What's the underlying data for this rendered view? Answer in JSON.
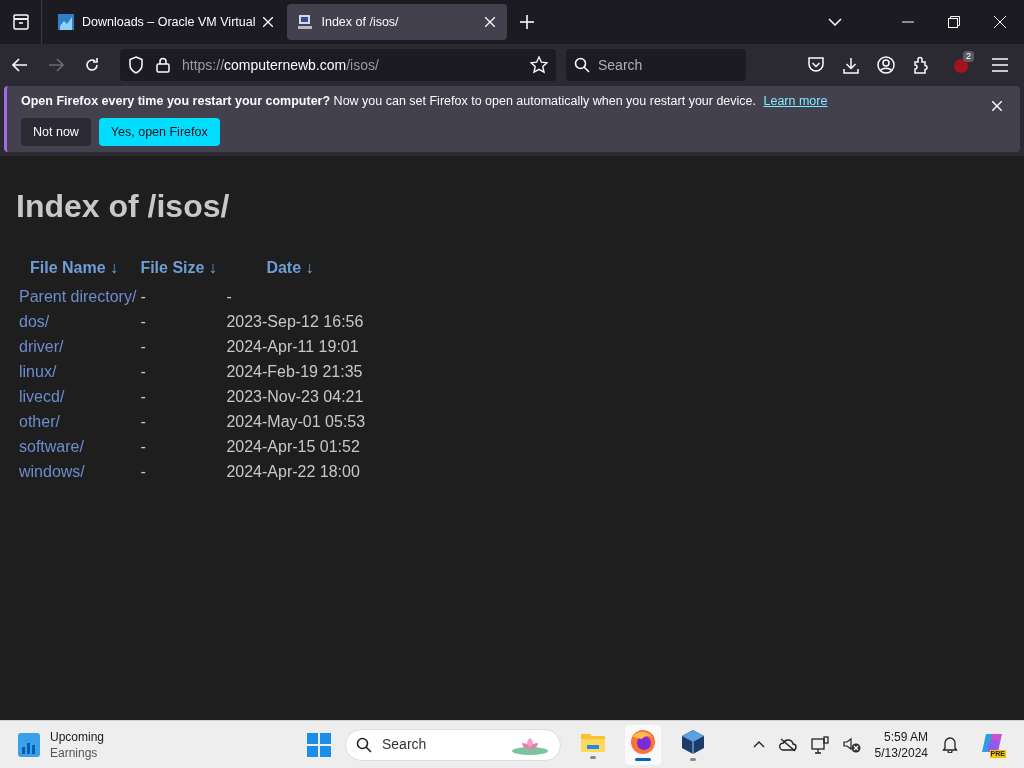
{
  "tabs": [
    {
      "title": "Downloads – Oracle VM Virtual",
      "selected": false,
      "kind": "vbox"
    },
    {
      "title": "Index of /isos/",
      "selected": true,
      "kind": "page"
    }
  ],
  "toolbar": {
    "url": {
      "scheme": "https://",
      "host": "computernewb.com",
      "path": "/isos/"
    },
    "search_placeholder": "Search",
    "extension_badge": "2"
  },
  "notification": {
    "bold": "Open Firefox every time you restart your computer?",
    "text": "Now you can set Firefox to open automatically when you restart your device.",
    "link": "Learn more",
    "buttons": [
      {
        "label": "Not now",
        "kind": "secondary"
      },
      {
        "label": "Yes, open Firefox",
        "kind": "primary"
      }
    ]
  },
  "page": {
    "title": "Index of /isos/",
    "columns": [
      {
        "label": "File Name",
        "sort": "↓"
      },
      {
        "label": "File Size",
        "sort": "↓"
      },
      {
        "label": "Date",
        "sort": "↓"
      }
    ],
    "rows": [
      {
        "name": "Parent directory/",
        "size": "-",
        "date": "-"
      },
      {
        "name": "dos/",
        "size": "-",
        "date": "2023-Sep-12 16:56"
      },
      {
        "name": "driver/",
        "size": "-",
        "date": "2024-Apr-11 19:01"
      },
      {
        "name": "linux/",
        "size": "-",
        "date": "2024-Feb-19 21:35"
      },
      {
        "name": "livecd/",
        "size": "-",
        "date": "2023-Nov-23 04:21"
      },
      {
        "name": "other/",
        "size": "-",
        "date": "2024-May-01 05:53"
      },
      {
        "name": "software/",
        "size": "-",
        "date": "2024-Apr-15 01:52"
      },
      {
        "name": "windows/",
        "size": "-",
        "date": "2024-Apr-22 18:00"
      }
    ]
  },
  "taskbar": {
    "widget": {
      "title": "Upcoming",
      "subtitle": "Earnings"
    },
    "search_placeholder": "Search",
    "apps": [
      {
        "kind": "files",
        "active": false
      },
      {
        "kind": "firefox",
        "active": true
      },
      {
        "kind": "vbox",
        "active": false
      }
    ],
    "clock": {
      "time": "5:59 AM",
      "date": "5/13/2024"
    },
    "copilot_badge": "PRE"
  }
}
